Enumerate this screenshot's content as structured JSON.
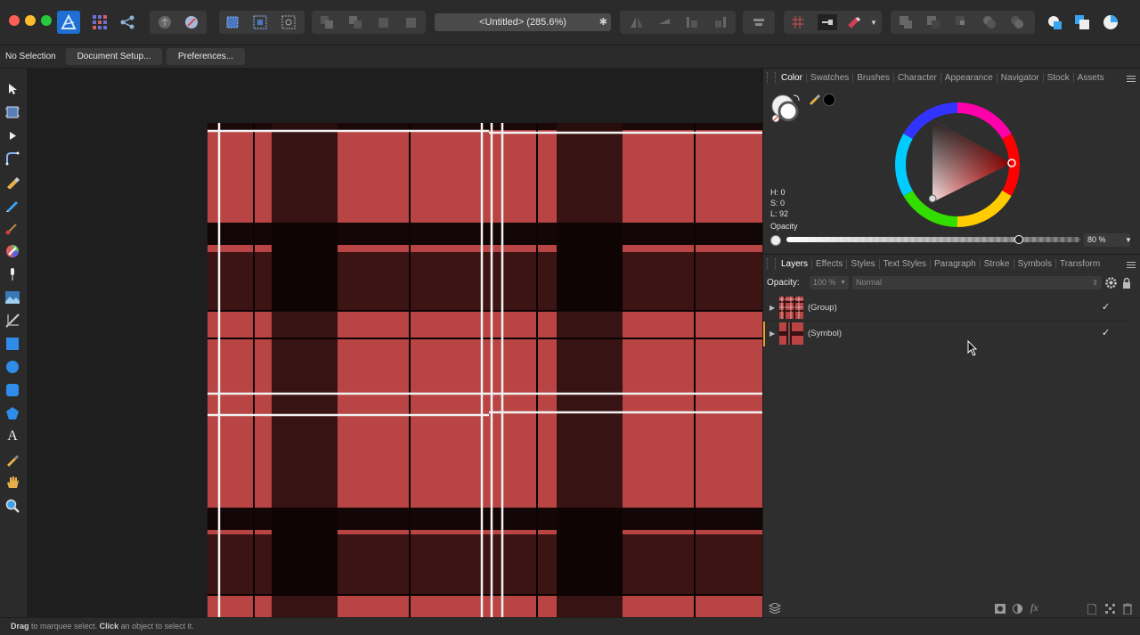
{
  "window": {
    "document_title": "<Untitled> (285.6%)",
    "modified_marker": "✱"
  },
  "context_bar": {
    "selection_label": "No Selection",
    "document_setup_label": "Document Setup...",
    "preferences_label": "Preferences..."
  },
  "left_tools": [
    "move-tool-icon",
    "artboard-tool-icon",
    "node-tool-icon",
    "corner-tool-icon",
    "pen-tool-icon",
    "pencil-tool-icon",
    "vector-brush-icon",
    "fill-tool-icon",
    "transparency-tool-icon",
    "place-image-icon",
    "vector-crop-icon",
    "rectangle-tool-icon",
    "ellipse-tool-icon",
    "rounded-rect-tool-icon",
    "polygon-tool-icon",
    "text-tool-icon",
    "color-picker-icon",
    "hand-tool-icon",
    "zoom-tool-icon"
  ],
  "color_panel": {
    "tabs": [
      "Color",
      "Swatches",
      "Brushes",
      "Character",
      "Appearance",
      "Navigator",
      "Stock",
      "Assets"
    ],
    "active_tab": "Color",
    "h": "H: 0",
    "s": "S: 0",
    "l": "L: 92",
    "opacity_label": "Opacity",
    "opacity_value": "80 %",
    "opacity_fraction": 0.8
  },
  "layers_panel": {
    "tabs": [
      "Layers",
      "Effects",
      "Styles",
      "Text Styles",
      "Paragraph",
      "Stroke",
      "Symbols",
      "Transform"
    ],
    "active_tab": "Layers",
    "opacity_label": "Opacity:",
    "opacity_value": "100 %",
    "blend_mode": "Normal",
    "layers": [
      {
        "name": "(Group)",
        "visible": true
      },
      {
        "name": "(Symbol)",
        "visible": true
      }
    ]
  },
  "status": {
    "drag_word": "Drag",
    "drag_text": "to marquee select.",
    "click_word": "Click",
    "click_text": "an object to select it."
  },
  "colors": {
    "plaid_red": "#b84444",
    "plaid_dark": "#3d1414",
    "accent_blue": "#3aa3f0"
  }
}
